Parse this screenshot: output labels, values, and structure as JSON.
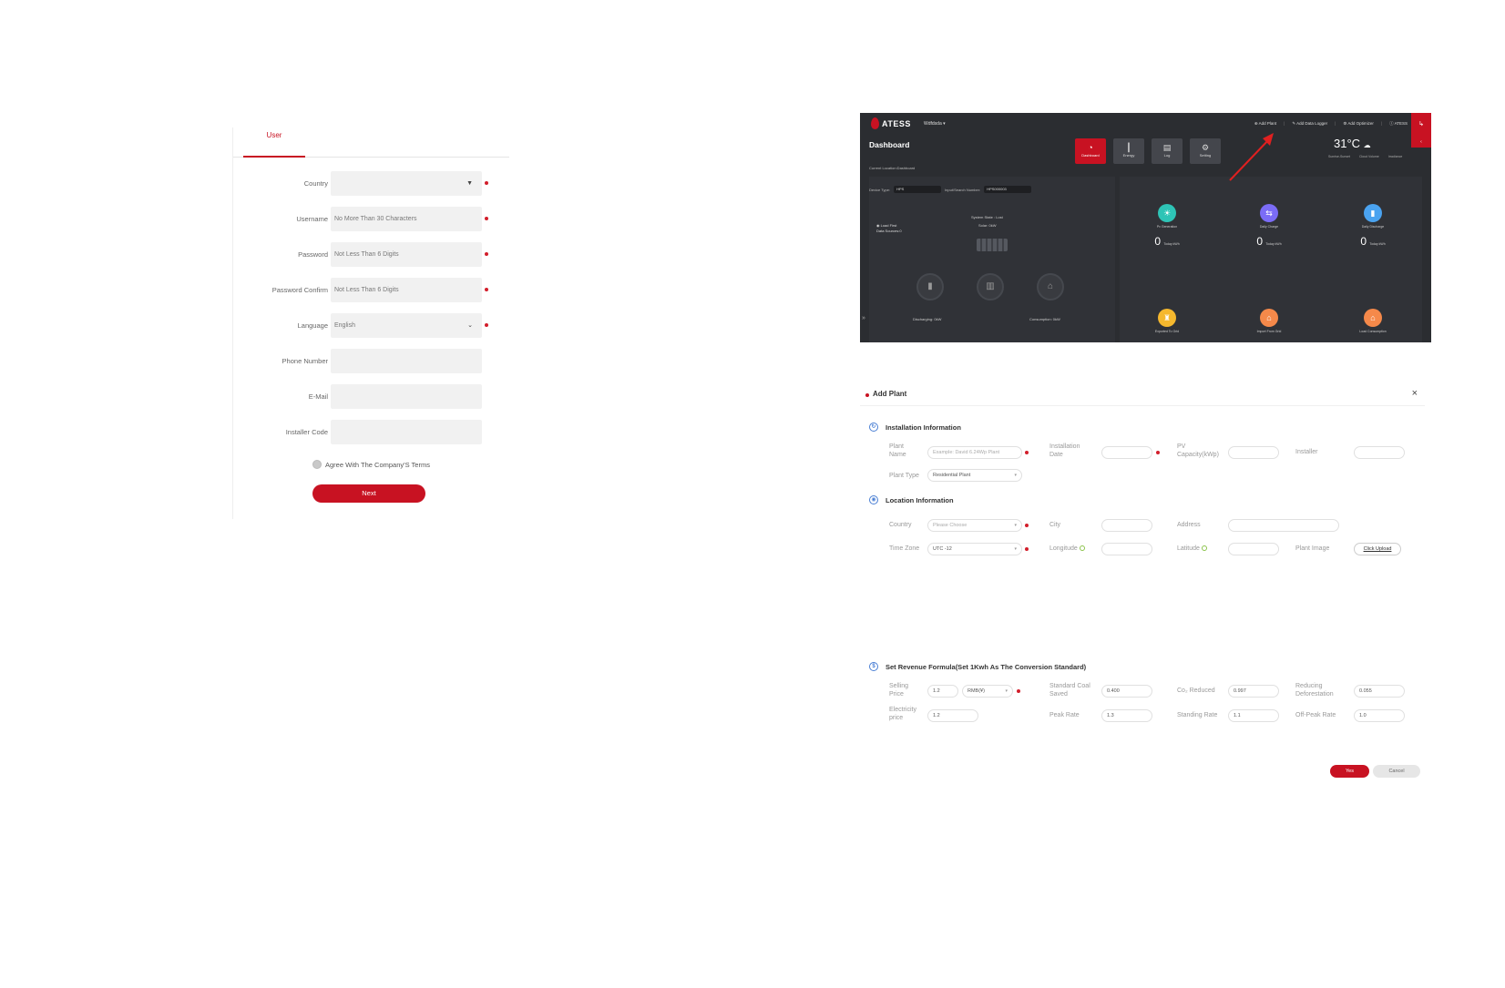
{
  "registration": {
    "tab": "User",
    "fields": [
      {
        "label": "Country",
        "value": "",
        "required": true,
        "type": "select"
      },
      {
        "label": "Username",
        "value": "No More Than 30 Characters",
        "required": true,
        "type": "input"
      },
      {
        "label": "Password",
        "value": "Not Less Than 6 Digits",
        "required": true,
        "type": "input"
      },
      {
        "label": "Password Confirm",
        "value": "Not Less Than 6 Digits",
        "required": true,
        "type": "input"
      },
      {
        "label": "Language",
        "value": "English",
        "required": true,
        "type": "select"
      },
      {
        "label": "Phone Number",
        "value": "",
        "required": false,
        "type": "input"
      },
      {
        "label": "E-Mail",
        "value": "",
        "required": false,
        "type": "input"
      },
      {
        "label": "Installer Code",
        "value": "",
        "required": false,
        "type": "input"
      }
    ],
    "agree": "Agree With The Company'S Terms",
    "next": "Next"
  },
  "dashboard": {
    "logo": "ATESS",
    "user": "Wdfdsda",
    "links": [
      "Add Plant",
      "Add Data Logger",
      "Add Optimizer",
      "ATESS"
    ],
    "exit_icon": "↳",
    "title": "Dashboard",
    "breadcrumb": "Current Location:Dashboard",
    "nav": [
      {
        "label": "Dashboard",
        "icon": "◔",
        "active": true
      },
      {
        "label": "Energy",
        "icon": "┃",
        "active": false
      },
      {
        "label": "Log",
        "icon": "▤",
        "active": false
      },
      {
        "label": "Setting",
        "icon": "⚙",
        "active": false
      }
    ],
    "temperature": "31°C",
    "weather_labels": [
      "Sunrise-Sunset",
      "Cloud Volume",
      "Irradiance"
    ],
    "device_type_label": "Device Type:",
    "device_type_value": "HPS",
    "search_label": "Input/Search Number:",
    "search_value": "HPS000003",
    "load_first": "Load First",
    "data_sources": "Data Sources:0",
    "system_state": "System State : Lost",
    "solar": "Solar: 0kW",
    "discharging": "Discharging: 0kW",
    "consumption": "Consumption: 0kW",
    "stats": [
      {
        "name": "Pv Generation",
        "value": "0",
        "unit": "Today kWh",
        "color": "#2ec4b6"
      },
      {
        "name": "Daily Charge",
        "value": "0",
        "unit": "Today kWh",
        "color": "#7b6cf6"
      },
      {
        "name": "Daily Discharge",
        "value": "0",
        "unit": "Today kWh",
        "color": "#4aa3f0"
      },
      {
        "name": "Exported To Grid",
        "value": "",
        "unit": "",
        "color": "#f5b82e"
      },
      {
        "name": "Import From Grid",
        "value": "",
        "unit": "",
        "color": "#f5894a"
      },
      {
        "name": "Load Consumption",
        "value": "",
        "unit": "",
        "color": "#f5894a"
      }
    ]
  },
  "add_plant": {
    "title": "Add Plant",
    "installation_section": "Installation Information",
    "plant_name_label": "Plant Name",
    "plant_name_placeholder": "Example: David 6.24Wp Plant",
    "installation_date_label": "Installation Date",
    "pv_capacity_label": "PV Capacity(kWp)",
    "installer_label": "Installer",
    "plant_type_label": "Plant Type",
    "plant_type_value": "Residential Plant",
    "location_section": "Location Information",
    "country_label": "Country",
    "country_placeholder": "Please Choose",
    "city_label": "City",
    "address_label": "Address",
    "timezone_label": "Time Zone",
    "timezone_value": "UTC -12",
    "longitude_label": "Longitude",
    "latitude_label": "Latitude",
    "plant_image_label": "Plant Image",
    "upload_label": "Click Upload",
    "revenue_section": "Set Revenue Formula(Set 1Kwh As The Conversion Standard)",
    "selling_price_label": "Selling Price",
    "selling_price_value": "1.2",
    "currency_value": "RMB(¥)",
    "coal_label": "Standard Coal Saved",
    "coal_value": "0.400",
    "co2_label": "Co₂ Reduced",
    "co2_value": "0.997",
    "deforestation_label": "Reducing Deforestation",
    "deforestation_value": "0.055",
    "electricity_price_label": "Electricity price",
    "electricity_price_value": "1.2",
    "peak_label": "Peak Rate",
    "peak_value": "1.3",
    "standing_label": "Standing Rate",
    "standing_value": "1.1",
    "offpeak_label": "Off-Peak Rate",
    "offpeak_value": "1.0",
    "yes": "Yes",
    "cancel": "Cancel"
  }
}
